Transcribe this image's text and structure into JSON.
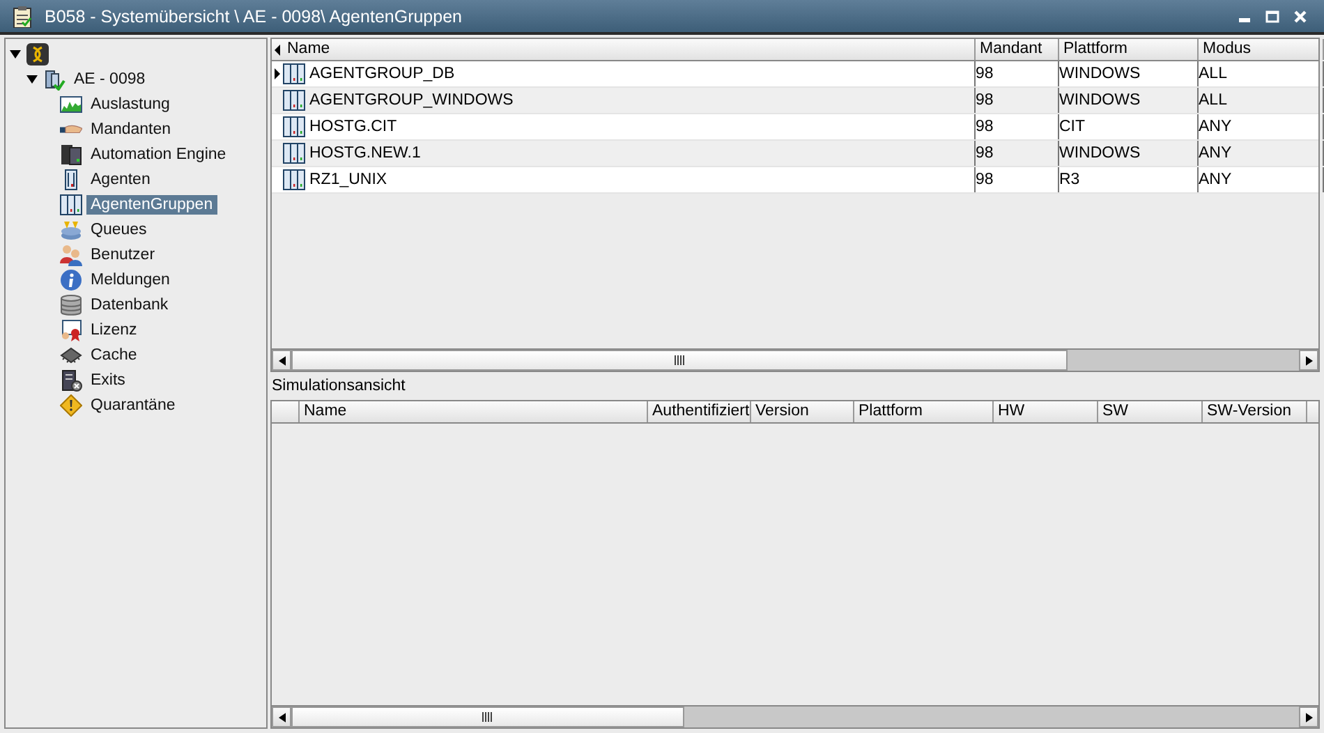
{
  "window": {
    "title": "B058 - Systemübersicht \\ AE - 0098\\ AgentenGruppen"
  },
  "tree": [
    {
      "kind": "root",
      "expanded": true,
      "selected": false,
      "children": [
        {
          "label": "AE - 0098",
          "kind": "system",
          "expanded": true,
          "selected": false,
          "children": [
            {
              "label": "Auslastung",
              "kind": "chart",
              "selected": false
            },
            {
              "label": "Mandanten",
              "kind": "hand",
              "selected": false
            },
            {
              "label": "Automation Engine",
              "kind": "server",
              "selected": false
            },
            {
              "label": "Agenten",
              "kind": "agent",
              "selected": false
            },
            {
              "label": "AgentenGruppen",
              "kind": "group",
              "selected": true
            },
            {
              "label": "Queues",
              "kind": "queue",
              "selected": false
            },
            {
              "label": "Benutzer",
              "kind": "users",
              "selected": false
            },
            {
              "label": "Meldungen",
              "kind": "info",
              "selected": false
            },
            {
              "label": "Datenbank",
              "kind": "database",
              "selected": false
            },
            {
              "label": "Lizenz",
              "kind": "license",
              "selected": false
            },
            {
              "label": "Cache",
              "kind": "chip",
              "selected": false
            },
            {
              "label": "Exits",
              "kind": "exits",
              "selected": false
            },
            {
              "label": "Quarantäne",
              "kind": "warning",
              "selected": false
            }
          ]
        }
      ]
    }
  ],
  "table": {
    "columns": [
      "Name",
      "Mandant",
      "Plattform",
      "Modus"
    ],
    "rows": [
      {
        "current": true,
        "cells": [
          "AGENTGROUP_DB",
          "98",
          "WINDOWS",
          "ALL"
        ]
      },
      {
        "current": false,
        "cells": [
          "AGENTGROUP_WINDOWS",
          "98",
          "WINDOWS",
          "ALL"
        ]
      },
      {
        "current": false,
        "cells": [
          "HOSTG.CIT",
          "98",
          "CIT",
          "ANY"
        ]
      },
      {
        "current": false,
        "cells": [
          "HOSTG.NEW.1",
          "98",
          "WINDOWS",
          "ANY"
        ]
      },
      {
        "current": false,
        "cells": [
          "RZ1_UNIX",
          "98",
          "R3",
          "ANY"
        ]
      }
    ]
  },
  "simulation": {
    "title": "Simulationsansicht",
    "columns": [
      "Name",
      "Authentifiziert",
      "Version",
      "Plattform",
      "HW",
      "SW",
      "SW-Version"
    ]
  }
}
